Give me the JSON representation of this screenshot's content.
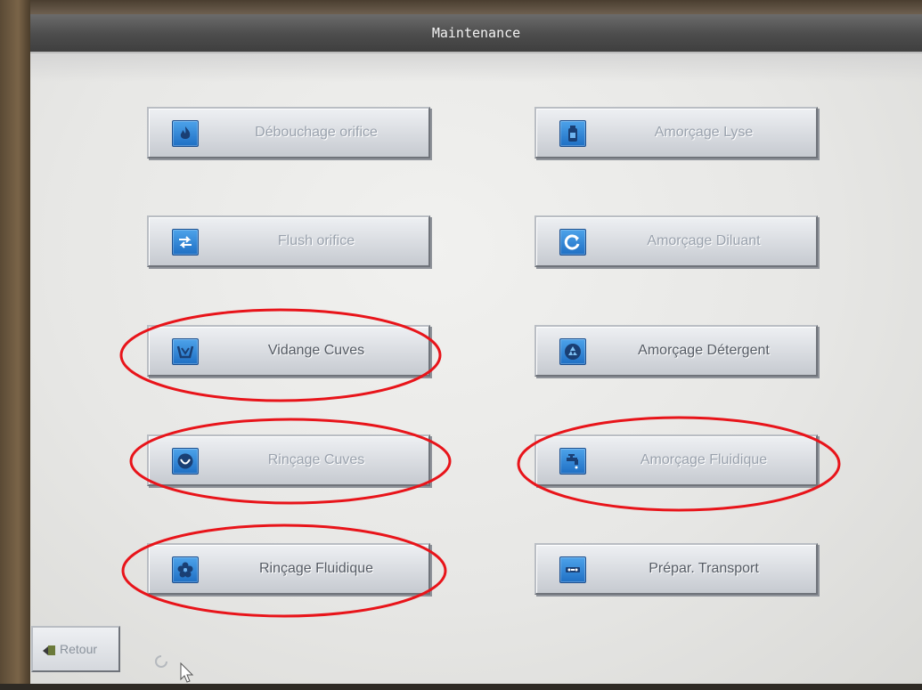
{
  "window": {
    "title": "Maintenance"
  },
  "buttons": [
    {
      "id": "debouchage-orifice",
      "label": "Débouchage orifice",
      "icon": "flame-icon"
    },
    {
      "id": "amorcage-lyse",
      "label": "Amorçage Lyse",
      "icon": "bottle-icon"
    },
    {
      "id": "flush-orifice",
      "label": "Flush orifice",
      "icon": "swap-arrows-icon"
    },
    {
      "id": "amorcage-diluant",
      "label": "Amorçage Diluant",
      "icon": "refresh-icon"
    },
    {
      "id": "vidange-cuves",
      "label": "Vidange Cuves",
      "icon": "basin-icon"
    },
    {
      "id": "amorcage-detergent",
      "label": "Amorçage Détergent",
      "icon": "recycle-icon"
    },
    {
      "id": "rincage-cuves",
      "label": "Rinçage Cuves",
      "icon": "bowl-icon"
    },
    {
      "id": "amorcage-fluidique",
      "label": "Amorçage Fluidique",
      "icon": "faucet-icon"
    },
    {
      "id": "rincage-fluidique",
      "label": "Rinçage Fluidique",
      "icon": "flower-icon"
    },
    {
      "id": "prepar-transport",
      "label": "Prépar. Transport",
      "icon": "transport-icon"
    }
  ],
  "footer": {
    "retour_label": "Retour",
    "retour_icon": "back-arrow-icon"
  },
  "colors": {
    "annotation": "#e8141a",
    "icon_blue": "#2a7fd6",
    "titlebar": "#4c4c4c"
  }
}
